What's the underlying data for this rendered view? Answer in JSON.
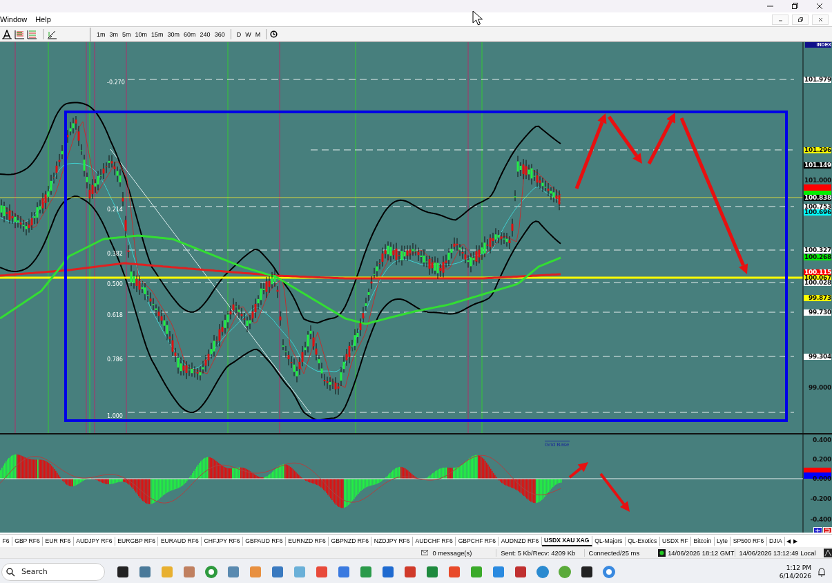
{
  "window": {
    "menu": [
      "Window",
      "Help"
    ]
  },
  "toolbar": {
    "timeframes": [
      "1m",
      "3m",
      "5m",
      "10m",
      "15m",
      "30m",
      "60m",
      "240",
      "360"
    ],
    "periods": [
      "D",
      "W",
      "M"
    ]
  },
  "chart": {
    "axis_header": "INDEX",
    "price_labels": [
      {
        "text": "101.979",
        "kind": "tag",
        "color": "#ffffff"
      },
      {
        "text": "101.296",
        "kind": "tag",
        "color": "#ffff00"
      },
      {
        "text": "101.149",
        "kind": "tag",
        "color": "#000000"
      },
      {
        "text": "101.000",
        "kind": "tick"
      },
      {
        "kind": "tag",
        "color": "#ff0000"
      },
      {
        "kind": "tag",
        "color": "#00ee00"
      },
      {
        "text": "100.838",
        "kind": "tag",
        "color": "#000000"
      },
      {
        "text": "100.753",
        "kind": "tag",
        "color": "#ffffff"
      },
      {
        "text": "100.696",
        "kind": "tag",
        "color": "#00ffff"
      },
      {
        "text": "100.327",
        "kind": "tag",
        "color": "#ffffff"
      },
      {
        "text": "100.268",
        "kind": "tag",
        "color": "#00ee00"
      },
      {
        "text": "100.115",
        "kind": "tag",
        "color": "#ff0000"
      },
      {
        "text": "100.067",
        "kind": "tag",
        "color": "#ffff00"
      },
      {
        "text": "100.028",
        "kind": "tag",
        "color": "#ffffff"
      },
      {
        "text": "99.873",
        "kind": "tag",
        "color": "#ffff00"
      },
      {
        "text": "99.730",
        "kind": "tag",
        "color": "#ffffff"
      },
      {
        "text": "99.304",
        "kind": "tag",
        "color": "#ffffff"
      },
      {
        "text": "99.000",
        "kind": "tick"
      }
    ],
    "fib_levels": [
      "-0.270",
      "0.214",
      "0.382",
      "0.500",
      "0.618",
      "0.786",
      "1.000"
    ],
    "indicator_title": "Grid Base",
    "oscillator_labels": [
      {
        "text": "0.400",
        "kind": "tick"
      },
      {
        "text": "0.200",
        "kind": "tick"
      },
      {
        "kind": "tag",
        "color": "#ff0000"
      },
      {
        "kind": "tag",
        "color": "#0000ff"
      },
      {
        "text": "0.000",
        "kind": "tick"
      },
      {
        "text": "-0.200",
        "kind": "tick"
      },
      {
        "text": "-0.400",
        "kind": "tick"
      }
    ]
  },
  "tabs": [
    {
      "label": "F6",
      "selected": false
    },
    {
      "label": "GBP RF6",
      "selected": false
    },
    {
      "label": "EUR RF6",
      "selected": false
    },
    {
      "label": "AUDJPY RF6",
      "selected": false
    },
    {
      "label": "EURGBP RF6",
      "selected": false
    },
    {
      "label": "EURAUD RF6",
      "selected": false
    },
    {
      "label": "CHFJPY RF6",
      "selected": false
    },
    {
      "label": "GBPAUD RF6",
      "selected": false
    },
    {
      "label": "EURNZD RF6",
      "selected": false
    },
    {
      "label": "GBPNZD RF6",
      "selected": false
    },
    {
      "label": "NZDJPY RF6",
      "selected": false
    },
    {
      "label": "AUDCHF RF6",
      "selected": false
    },
    {
      "label": "GBPCHF RF6",
      "selected": false
    },
    {
      "label": "AUDNZD RF6",
      "selected": false
    },
    {
      "label": "USDX XAU XAG",
      "selected": true
    },
    {
      "label": "QL-Majors",
      "selected": false
    },
    {
      "label": "QL-Exotics",
      "selected": false
    },
    {
      "label": "USDX RF",
      "selected": false
    },
    {
      "label": "Bitcoin",
      "selected": false
    },
    {
      "label": "Lyte",
      "selected": false
    },
    {
      "label": "SP500 RF6",
      "selected": false
    },
    {
      "label": "DJIA",
      "selected": false
    }
  ],
  "tab_arrows": [
    "◀",
    "▶"
  ],
  "status_bar": {
    "messages": "0 message(s)",
    "traffic": "Sent: 5 Kb/Recv: 4209 Kb",
    "connection": "Connected/25 ms",
    "gmt_time": "14/06/2026 18:12 GMT",
    "local_time": "14/06/2026 13:12:49 Local"
  },
  "taskbar": {
    "search": {
      "placeholder": "Search"
    },
    "time": "1:12 PM",
    "date": "6/14/2026"
  }
}
